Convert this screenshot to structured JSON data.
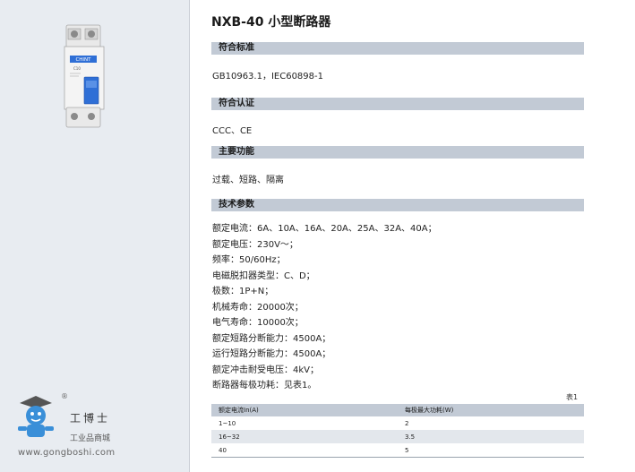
{
  "title": "NXB-40 小型断路器",
  "sections": {
    "standards": {
      "heading": "符合标准",
      "text": "GB10963.1，IEC60898-1"
    },
    "certification": {
      "heading": "符合认证",
      "text": "CCC、CE"
    },
    "functions": {
      "heading": "主要功能",
      "text": "过载、短路、隔离"
    },
    "technical": {
      "heading": "技术参数",
      "lines": [
        "额定电流：6A、10A、16A、20A、25A、32A、40A；",
        "额定电压：230V～；",
        "频率：50/60Hz；",
        "电磁脱扣器类型：C、D；",
        "极数：1P+N；",
        "机械寿命：20000次；",
        "电气寿命：10000次；",
        "额定短路分断能力：4500A；",
        "运行短路分断能力：4500A；",
        "额定冲击耐受电压：4kV；",
        "断路器每极功耗：见表1。"
      ]
    }
  },
  "table": {
    "label": "表1",
    "headers": [
      "额定电流In(A)",
      "每极最大功耗(W)"
    ],
    "rows": [
      [
        "1~10",
        "2"
      ],
      [
        "16~32",
        "3.5"
      ],
      [
        "40",
        "5"
      ]
    ]
  },
  "product": {
    "brand_text": "CHINT",
    "rating_text": "C10"
  },
  "logo": {
    "registered": "®",
    "brand_cn": "工博士",
    "sub": "工业品商城",
    "url": "www.gongboshi.com"
  },
  "colors": {
    "left_panel": "#e8ecf1",
    "section_bar": "#c2cad5",
    "breaker_blue": "#2f6fd6",
    "logo_blue": "#3a8fd8"
  }
}
